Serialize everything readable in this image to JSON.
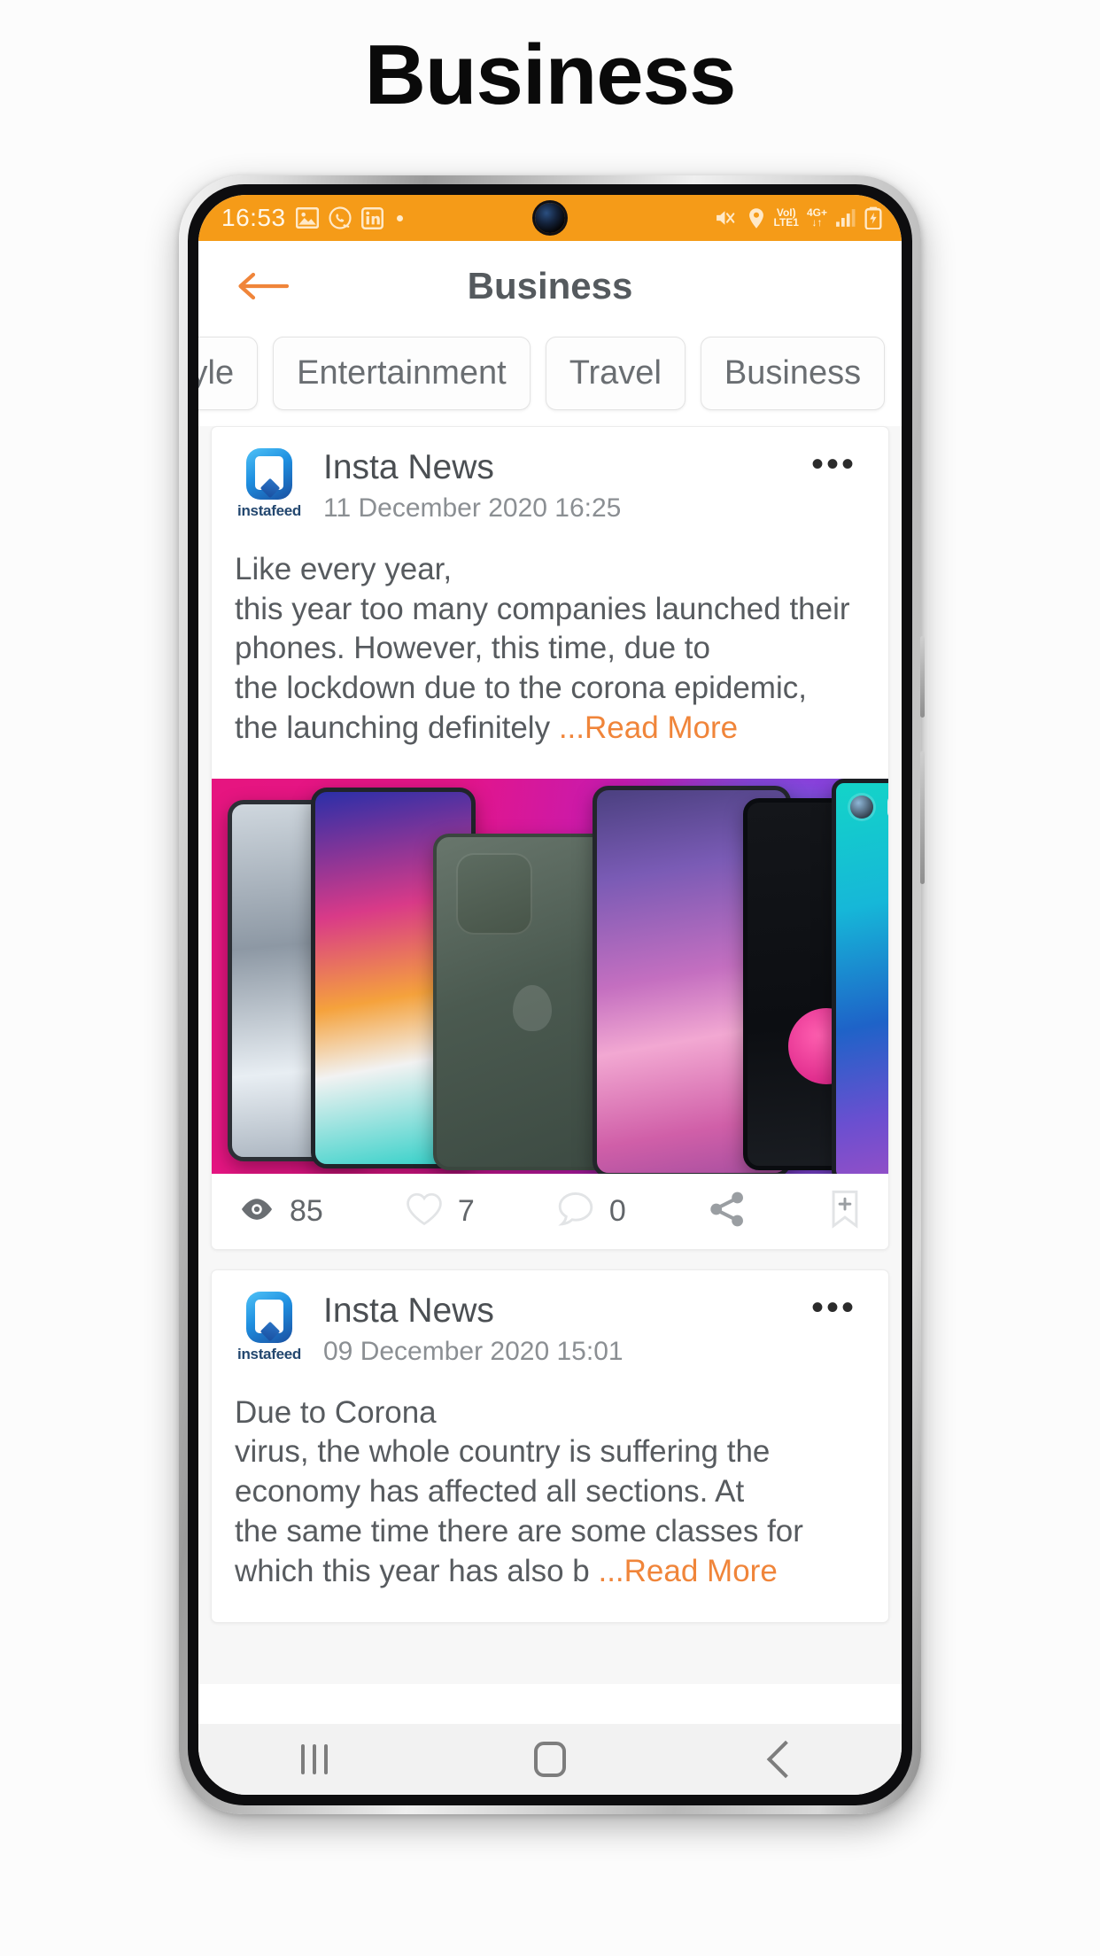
{
  "page": {
    "heading": "Business",
    "background_color": "#fcfcfc"
  },
  "theme": {
    "accent": "#f59b18",
    "accent_link": "#f0853a",
    "text_primary": "#4b4f53",
    "text_secondary": "#8b8f93",
    "card_bg": "#ffffff",
    "feed_bg": "#f7f7f7"
  },
  "status_bar": {
    "time": "16:53",
    "left_icons": [
      "gallery-icon",
      "whatsapp-icon",
      "linkedin-icon",
      "dot-indicator"
    ],
    "right_icons": [
      "mute-vibrate-icon",
      "location-icon",
      "volte-icon",
      "network-4gplus-icon",
      "signal-bars-icon",
      "battery-charging-icon"
    ],
    "volte_line1": "VoI)",
    "volte_line2": "LTE1",
    "network_line1": "4G+",
    "network_line2": "↓↑"
  },
  "app_header": {
    "back_label": "back-arrow",
    "title": "Business"
  },
  "tabs": [
    {
      "label": "tyle",
      "selected": false
    },
    {
      "label": "Entertainment",
      "selected": false
    },
    {
      "label": "Travel",
      "selected": false
    },
    {
      "label": "Business",
      "selected": true
    }
  ],
  "posts": [
    {
      "author": "Insta News",
      "avatar_label": "instafeed",
      "date": "11 December 2020 16:25",
      "more_label": "•••",
      "body_lines": [
        "Like every year,",
        "this year too many companies launched their",
        "phones. However, this time, due to",
        "the lockdown due to the corona epidemic,",
        "the launching definitely "
      ],
      "read_more": "...Read More",
      "has_image": true,
      "image_alt": "collage of smartphones on pink gradient background",
      "stats": {
        "views": "85",
        "likes": "7",
        "comments": "0"
      }
    },
    {
      "author": "Insta News",
      "avatar_label": "instafeed",
      "date": "09 December 2020 15:01",
      "more_label": "•••",
      "body_lines": [
        "Due to Corona",
        "virus, the whole country is suffering the",
        "economy has affected all sections. At",
        "the same time there are some classes for",
        "which this year has also b "
      ],
      "read_more": "...Read More",
      "has_image": false,
      "stats": null
    }
  ],
  "nav_bar": {
    "recents_label": "recents-button",
    "home_label": "home-button",
    "back_label": "back-button"
  }
}
